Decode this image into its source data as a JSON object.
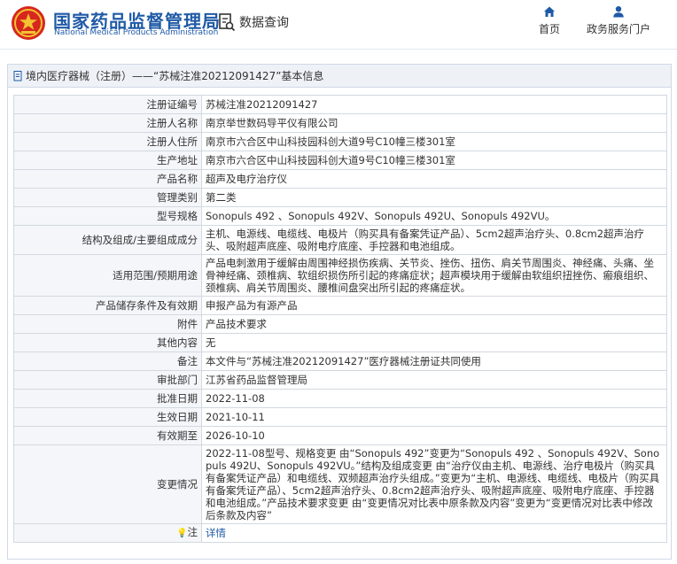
{
  "header": {
    "site_name": "国家药品监督管理局",
    "site_name_en": "National Medical Products Administration",
    "search_label": "数据查询",
    "nav": [
      {
        "label": "首页",
        "icon": "home-icon"
      },
      {
        "label": "政务服务门户",
        "icon": "user-icon"
      }
    ]
  },
  "panel": {
    "title": "境内医疗器械（注册）——“苏械注准20212091427”基本信息"
  },
  "rows": [
    {
      "label": "注册证编号",
      "value": "苏械注准20212091427"
    },
    {
      "label": "注册人名称",
      "value": "南京举世数码导平仪有限公司"
    },
    {
      "label": "注册人住所",
      "value": "南京市六合区中山科技园科创大道9号C10幢三楼301室"
    },
    {
      "label": "生产地址",
      "value": "南京市六合区中山科技园科创大道9号C10幢三楼301室"
    },
    {
      "label": "产品名称",
      "value": "超声及电疗治疗仪"
    },
    {
      "label": "管理类别",
      "value": "第二类"
    },
    {
      "label": "型号规格",
      "value": "Sonopuls 492 、Sonopuls 492V、Sonopuls 492U、Sonopuls 492VU。"
    },
    {
      "label": "结构及组成/主要组成成分",
      "value": "主机、电源线、电缆线、电极片（购买具有备案凭证产品）、5cm2超声治疗头、0.8cm2超声治疗头、吸附超声底座、吸附电疗底座、手控器和电池组成。"
    },
    {
      "label": "适用范围/预期用途",
      "value": "产品电刺激用于缓解由周围神经损伤疾病、关节炎、挫伤、扭伤、肩关节周围炎、神经痛、头痛、坐骨神经痛、颈椎病、软组织损伤所引起的疼痛症状；超声模块用于缓解由软组织扭挫伤、瘢痕组织、颈椎病、肩关节周围炎、腰椎间盘突出所引起的疼痛症状。"
    },
    {
      "label": "产品储存条件及有效期",
      "value": "申报产品为有源产品"
    },
    {
      "label": "附件",
      "value": "产品技术要求"
    },
    {
      "label": "其他内容",
      "value": "无"
    },
    {
      "label": "备注",
      "value": "本文件与“苏械注准20212091427”医疗器械注册证共同使用"
    },
    {
      "label": "审批部门",
      "value": "江苏省药品监督管理局"
    },
    {
      "label": "批准日期",
      "value": "2022-11-08"
    },
    {
      "label": "生效日期",
      "value": "2021-10-11"
    },
    {
      "label": "有效期至",
      "value": "2026-10-10"
    },
    {
      "label": "变更情况",
      "value": "2022-11-08型号、规格变更 由“Sonopuls 492”变更为“Sonopuls 492 、Sonopuls 492V、Sonopuls 492U、Sonopuls 492VU。”结构及组成变更 由“治疗仪由主机、电源线、治疗电极片（购买具有备案凭证产品）和电缆线、双频超声治疗头组成。”变更为“主机、电源线、电缆线、电极片（购买具有备案凭证产品）、5cm2超声治疗头、0.8cm2超声治疗头、吸附超声底座、吸附电疗底座、手控器和电池组成。”产品技术要求变更 由“变更情况对比表中原条款及内容”变更为“变更情况对比表中修改后条款及内容”"
    }
  ],
  "note": {
    "label": "注",
    "icon": "bulb-icon",
    "value": "详情"
  },
  "colors": {
    "brand": "#1f5aa6",
    "label_bg": "#f4f6f9",
    "border": "#d3d9e1",
    "emblem_red": "#d7261e",
    "emblem_gold": "#f2c230"
  }
}
